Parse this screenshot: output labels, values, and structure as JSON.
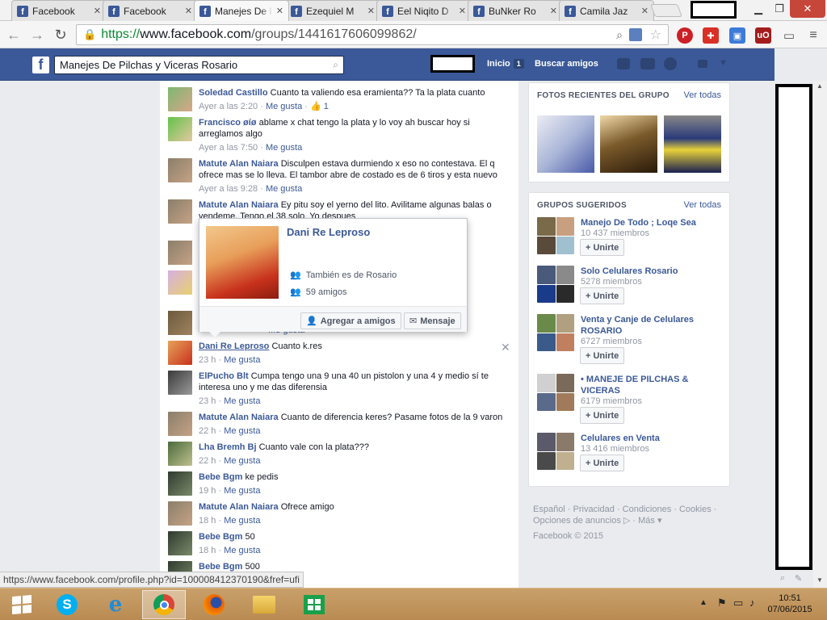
{
  "tabs": [
    {
      "label": "Facebook"
    },
    {
      "label": "Facebook"
    },
    {
      "label": "Manejes De Pilchas"
    },
    {
      "label": "Ezequiel M"
    },
    {
      "label": "Eel Niqito D"
    },
    {
      "label": "BuNker Ro"
    },
    {
      "label": "Camila Jaz"
    }
  ],
  "address": {
    "https": "https://",
    "host": "www.facebook.com",
    "path": "/groups/1441617606099862/"
  },
  "fb": {
    "search_value": "Manejes De Pilchas y Viceras Rosario",
    "home_label": "Inicio",
    "home_badge": "1",
    "find_friends_label": "Buscar amigos"
  },
  "comments": [
    {
      "author": "Soledad Castillo",
      "text": "Cuanto ta valiendo esa eramienta?? Ta la plata cuanto",
      "time": "Ayer a las 2:20",
      "like": "Me gusta",
      "likes": "1"
    },
    {
      "author": "Francisco øíø",
      "text": "ablame x chat tengo la plata y lo voy ah buscar hoy si arreglamos algo",
      "time": "Ayer a las 7:50",
      "like": "Me gusta"
    },
    {
      "author": "Matute Alan Naiara",
      "text": "Disculpen estava durmiendo x eso no contestava. El q ofrece mas se lo lleva. El tambor abre de costado es de 6 tiros y esta nuevo",
      "time": "Ayer a las 9:28",
      "like": "Me gusta"
    },
    {
      "author": "Matute Alan Naiara",
      "text": "Ey pitu soy el yerno del lito. Avilitame algunas balas o vendeme. Tengo el 38 solo. Yo despues"
    },
    {
      "author": "Dani Re Leproso",
      "text": "Cuanto k.res",
      "time": "23 h",
      "like": "Me gusta"
    },
    {
      "author": "ElPucho Blt",
      "text": "Cumpa tengo una 9 una 40 un pistolon y una 4 y medio sí te interesa uno y me das diferensia",
      "time": "23 h",
      "like": "Me gusta"
    },
    {
      "author": "Matute Alan Naiara",
      "text": "Cuanto de diferencia keres? Pasame fotos de la 9 varon",
      "time": "22 h",
      "like": "Me gusta"
    },
    {
      "author": "Lha Bremh Bj",
      "text": "Cuanto vale con la plata???",
      "time": "22 h",
      "like": "Me gusta"
    },
    {
      "author": "Bebe Bgm",
      "text": "ke pedis",
      "time": "19 h",
      "like": "Me gusta"
    },
    {
      "author": "Matute Alan Naiara",
      "text": "Ofrece amigo",
      "time": "18 h",
      "like": "Me gusta"
    },
    {
      "author": "Bebe Bgm",
      "text": "50",
      "time": "18 h",
      "like": "Me gusta"
    },
    {
      "author": "Bebe Bgm",
      "text": "500"
    }
  ],
  "hidden_meta": {
    "like": "Me gusta"
  },
  "hovercard": {
    "name": "Dani Re Leproso",
    "info1": "También es de Rosario",
    "info2": "59 amigos",
    "add_friend": "Agregar a amigos",
    "message": "Mensaje"
  },
  "photos": {
    "title": "FOTOS RECIENTES DEL GRUPO",
    "see_all": "Ver todas"
  },
  "groups": {
    "title": "GRUPOS SUGERIDOS",
    "see_all": "Ver todas",
    "items": [
      {
        "name": "Manejo De Todo ; Loqe Sea",
        "members": "10 437 miembros",
        "join": "+ Unirte"
      },
      {
        "name": "Solo Celulares Rosario",
        "members": "5278 miembros",
        "join": "+ Unirte"
      },
      {
        "name": "Venta y Canje de Celulares ROSARIO",
        "members": "6727 miembros",
        "join": "+ Unirte"
      },
      {
        "name": "• MANEJE DE PILCHAS & VICERAS",
        "members": "6179 miembros",
        "join": "+ Unirte"
      },
      {
        "name": "Celulares en Venta",
        "members": "13 416 miembros",
        "join": "+ Unirte"
      }
    ]
  },
  "footer": {
    "line1": "Español · Privacidad · Condiciones · Cookies ·",
    "line2": "Opciones de anuncios ▷ · Más ▾",
    "copyright": "Facebook © 2015"
  },
  "status_url": "https://www.facebook.com/profile.php?id=100008412370190&fref=ufi",
  "clock": {
    "time": "10:51",
    "date": "07/06/2015"
  },
  "colors": {
    "fb_blue": "#3b5998",
    "link": "#3b5998",
    "meta": "#9197a3"
  }
}
